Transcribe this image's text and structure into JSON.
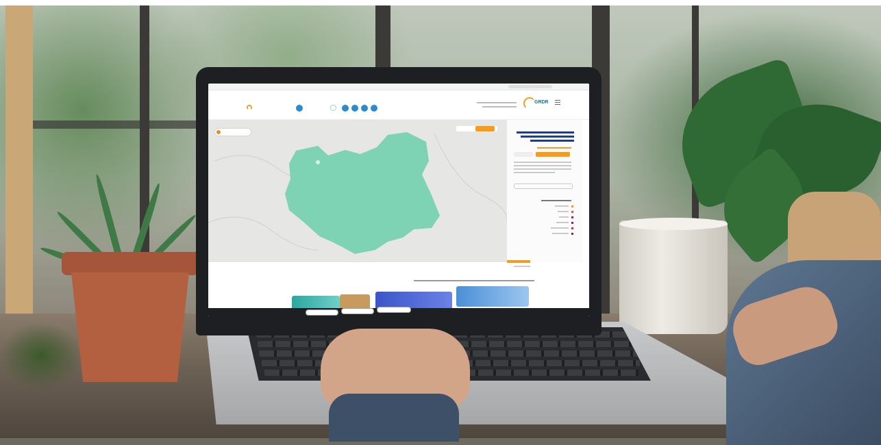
{
  "scene": {
    "description_visible_text": "",
    "laptop_brand_logo": "",
    "colors": {
      "map_region": "#7dd3b4",
      "accent_orange": "#f59b1d",
      "brand_blue": "#1d6fb0",
      "nav_blue": "#2b8bd0"
    }
  },
  "website": {
    "header": {
      "nav_items": [
        "",
        "",
        ""
      ],
      "social_icons": [
        "circle-icon",
        "circle-icon",
        "circle-icon",
        "circle-icon"
      ],
      "logo_text": "GRDR",
      "contact_lines": [
        "",
        ""
      ]
    },
    "map": {
      "legend_label": "",
      "toggle_labels": [
        "",
        ""
      ]
    },
    "side_panel": {
      "title": "",
      "button_label": "",
      "legend_items": [
        "",
        "",
        "",
        "",
        "",
        ""
      ]
    },
    "section": {
      "title": "",
      "subtitle": ""
    },
    "footer_pills": [
      "",
      "",
      ""
    ]
  }
}
